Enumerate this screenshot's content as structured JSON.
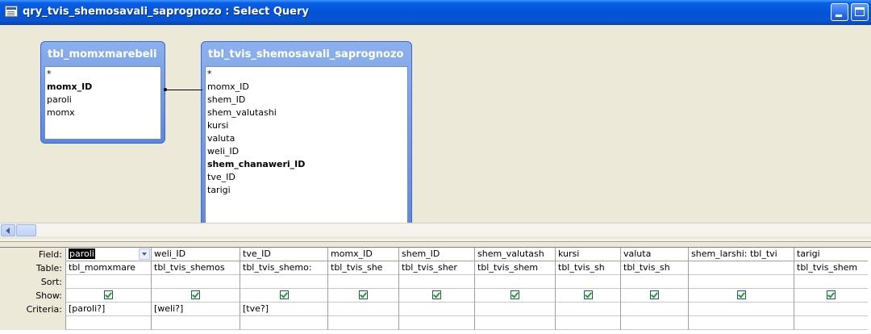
{
  "window": {
    "title": "qry_tvis_shemosavali_saprognozo : Select Query"
  },
  "tables": [
    {
      "name": "tbl_momxmarebeli",
      "fields": [
        {
          "label": "*",
          "key": false
        },
        {
          "label": "momx_ID",
          "key": true
        },
        {
          "label": "paroli",
          "key": false
        },
        {
          "label": "momx",
          "key": false
        }
      ]
    },
    {
      "name": "tbl_tvis_shemosavali_saprognozo",
      "fields": [
        {
          "label": "*",
          "key": false
        },
        {
          "label": "momx_ID",
          "key": false
        },
        {
          "label": "shem_ID",
          "key": false
        },
        {
          "label": "shem_valutashi",
          "key": false
        },
        {
          "label": "kursi",
          "key": false
        },
        {
          "label": "valuta",
          "key": false
        },
        {
          "label": "weli_ID",
          "key": false
        },
        {
          "label": "shem_chanaweri_ID",
          "key": true
        },
        {
          "label": "tve_ID",
          "key": false
        },
        {
          "label": "tarigi",
          "key": false
        }
      ]
    }
  ],
  "grid": {
    "row_labels": [
      "Field:",
      "Table:",
      "Sort:",
      "Show:",
      "Criteria:"
    ],
    "columns": [
      {
        "field": "paroli",
        "table": "tbl_momxmare",
        "sort": "",
        "show": true,
        "criteria": "[paroli?]"
      },
      {
        "field": "weli_ID",
        "table": "tbl_tvis_shemos",
        "sort": "",
        "show": true,
        "criteria": "[weli?]"
      },
      {
        "field": "tve_ID",
        "table": "tbl_tvis_shemo:",
        "sort": "",
        "show": true,
        "criteria": "[tve?]"
      },
      {
        "field": "momx_ID",
        "table": "tbl_tvis_she",
        "sort": "",
        "show": true,
        "criteria": ""
      },
      {
        "field": "shem_ID",
        "table": "tbl_tvis_sher",
        "sort": "",
        "show": true,
        "criteria": ""
      },
      {
        "field": "shem_valutash",
        "table": "tbl_tvis_shem",
        "sort": "",
        "show": true,
        "criteria": ""
      },
      {
        "field": "kursi",
        "table": "tbl_tvis_sh",
        "sort": "",
        "show": true,
        "criteria": ""
      },
      {
        "field": "valuta",
        "table": "tbl_tvis_sh",
        "sort": "",
        "show": true,
        "criteria": ""
      },
      {
        "field": "shem_larshi: tbl_tvi",
        "table": "",
        "sort": "",
        "show": true,
        "criteria": ""
      },
      {
        "field": "tarigi",
        "table": "tbl_tvis_shem",
        "sort": "",
        "show": true,
        "criteria": ""
      }
    ]
  },
  "colors": {
    "titlebar": "#0353d6",
    "fieldlist_header": "#6f97e3",
    "checkbox_check": "#21a121",
    "background": "#ece9d8"
  }
}
